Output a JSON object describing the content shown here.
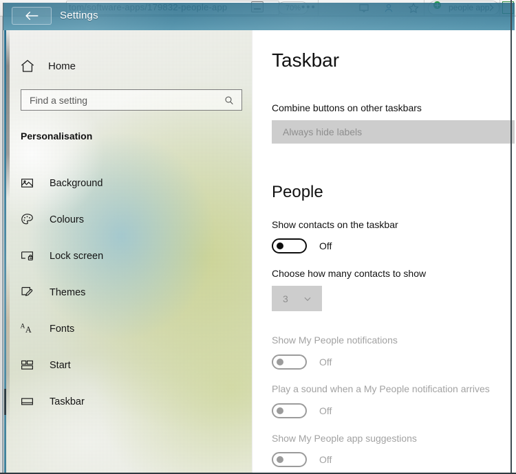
{
  "browser": {
    "url": "tom/software-apps/179832-people-app",
    "zoom_level": "70%",
    "search_value": "people app",
    "icons": [
      "minimize-icon",
      "more-icon",
      "reading-view-icon",
      "favorites-icon",
      "hub-icon",
      "downloads-icon",
      "notes-icon",
      "share-icon"
    ]
  },
  "window": {
    "title": "Settings",
    "back_icon": "back-arrow-icon"
  },
  "sidebar": {
    "home_label": "Home",
    "home_icon": "home-icon",
    "search": {
      "placeholder": "Find a setting",
      "icon": "search-icon"
    },
    "group_title": "Personalisation",
    "items": [
      {
        "label": "Background",
        "icon": "picture-icon",
        "selected": false
      },
      {
        "label": "Colours",
        "icon": "palette-icon",
        "selected": false
      },
      {
        "label": "Lock screen",
        "icon": "lock-screen-icon",
        "selected": false
      },
      {
        "label": "Themes",
        "icon": "brush-icon",
        "selected": false
      },
      {
        "label": "Fonts",
        "icon": "fonts-icon",
        "selected": false
      },
      {
        "label": "Start",
        "icon": "start-tiles-icon",
        "selected": false
      },
      {
        "label": "Taskbar",
        "icon": "taskbar-icon",
        "selected": true
      }
    ]
  },
  "main": {
    "page_title": "Taskbar",
    "combine_label": "Combine buttons on other taskbars",
    "combine_value": "Always hide labels",
    "combine_disabled": true,
    "people_section_title": "People",
    "show_contacts": {
      "label": "Show contacts on the taskbar",
      "state": "Off",
      "disabled": false
    },
    "contacts_count": {
      "label": "Choose how many contacts to show",
      "value": "3",
      "disabled": true
    },
    "notifications": {
      "label": "Show My People notifications",
      "state": "Off",
      "disabled": true
    },
    "sound": {
      "label": "Play a sound when a My People notification arrives",
      "state": "Off",
      "disabled": true
    },
    "suggestions": {
      "label": "Show My People app suggestions",
      "state": "Off",
      "disabled": true
    }
  },
  "colors": {
    "titlebar": "#2b7091",
    "accent_selection": "#2c3b43",
    "disabled_text": "#a2a2a2",
    "combo_background": "#cdcdcd"
  }
}
